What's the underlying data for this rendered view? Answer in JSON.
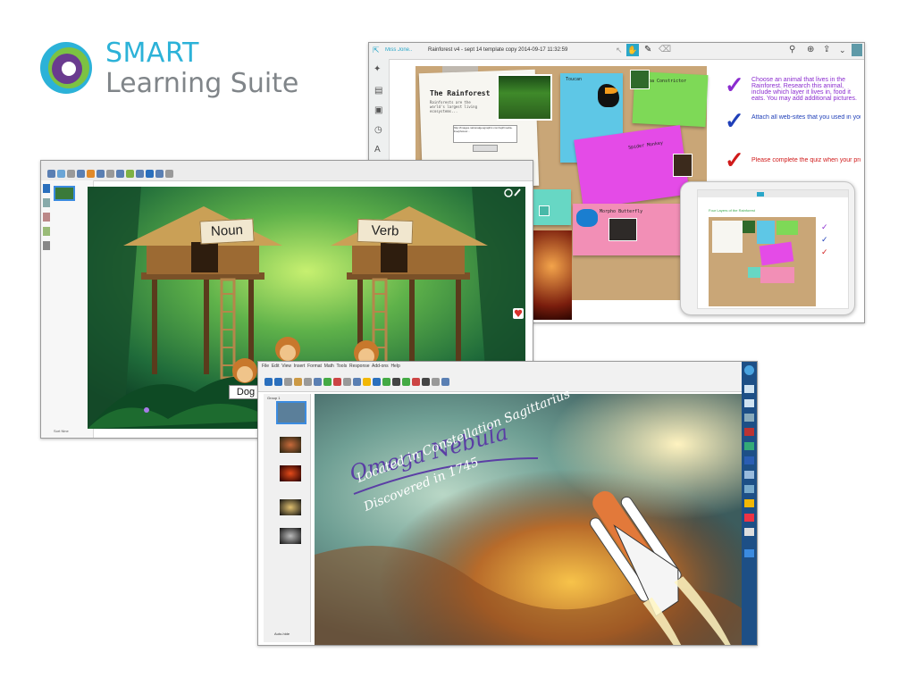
{
  "brand": {
    "line1": "SMART",
    "line2": "Learning Suite",
    "colors": {
      "blue": "#2cb2d8",
      "green": "#7cc242",
      "purple": "#6a3b8f",
      "gray": "#808589"
    }
  },
  "rainforest_window": {
    "tab_label": "Rainforest v4 - sept 14 template copy 2014-09-17 11:32:59",
    "board_title": "The Rainforest",
    "intro_text": "Rainforests are the world's largest living ecosystems...",
    "url_text": "http://images.nationalgeographic.com/wpf/media-live/photos/...",
    "cards": [
      {
        "label": "Toucan"
      },
      {
        "label": "Boa Constrictor"
      },
      {
        "label": "Spider Monkey"
      },
      {
        "label": "Morpho Butterfly"
      }
    ],
    "tasks": [
      {
        "text": "Choose an animal that lives in the Rainforest. Research this animal, include which layer it lives in, food it eats. You may add additional pictures.",
        "color": "#8b2ccf"
      },
      {
        "text": "Attach all web-sites that you used in your research.",
        "color": "#1f3fb8"
      },
      {
        "text": "Please complete the quiz when your project is done.",
        "color": "#d01a1a"
      }
    ],
    "tablet_heading": "Four Layers of the Rainforest"
  },
  "jungle_window": {
    "hut_labels": [
      "Noun",
      "Verb"
    ],
    "word_card": "Dog",
    "footer_text": "Sort Nine"
  },
  "nebula_window": {
    "menu": [
      "File",
      "Edit",
      "View",
      "Insert",
      "Format",
      "Math",
      "Tools",
      "Response",
      "Add-ons",
      "Help"
    ],
    "title": "Omega Nebula",
    "subtitle_line1": "Located in Constellation Sagittarius",
    "subtitle_line2": "Discovered in 1745",
    "autohide_label": "Auto-hide",
    "page_label": "Group 1"
  }
}
